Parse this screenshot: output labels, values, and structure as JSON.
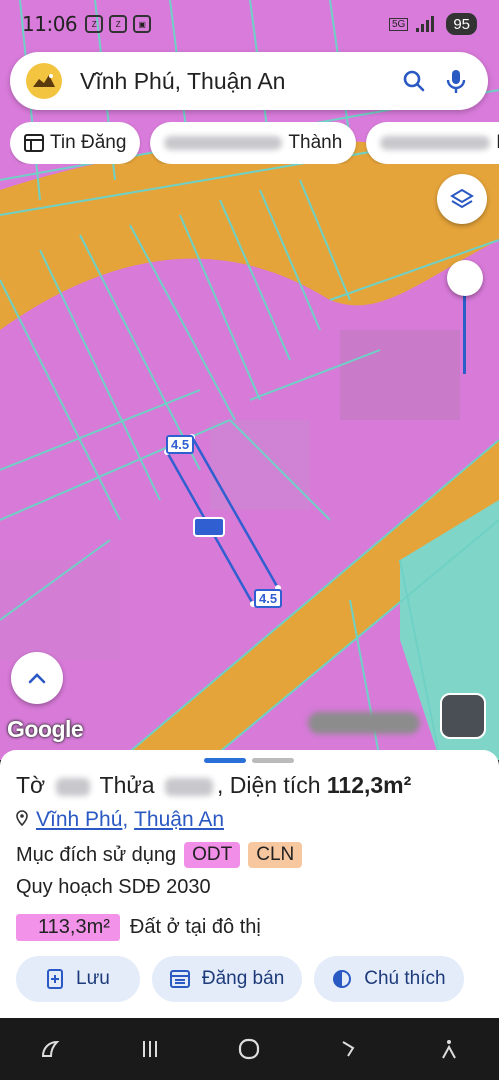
{
  "status_bar": {
    "time": "11:06",
    "network": "5G",
    "battery": "95"
  },
  "search": {
    "query": "Vĩnh Phú, Thuận An"
  },
  "chips": [
    {
      "label": "Tin Đăng"
    },
    {
      "label": "Thành"
    },
    {
      "label": "M"
    }
  ],
  "map": {
    "edge_label_top": "4.5",
    "edge_label_bottom": "4.5",
    "google_label": "Google"
  },
  "sheet": {
    "title_prefix": "Tờ",
    "title_middle": "Thửa",
    "title_suffix": ", Diện tích",
    "area": "112,3m²",
    "location_ward": "Vĩnh Phú",
    "location_sep": ",",
    "location_district": "Thuận An",
    "purpose_label": "Mục đích sử dụng",
    "purpose_tags": [
      {
        "code": "ODT",
        "color": "#f08ee8"
      },
      {
        "code": "CLN",
        "color": "#f7c7a0"
      }
    ],
    "plan_label": "Quy hoạch SDĐ 2030",
    "plan_area": "113,3m²",
    "plan_desc": "Đất ở tại đô thị"
  },
  "actions": [
    {
      "label": "Lưu",
      "icon": "bookmark-plus-icon"
    },
    {
      "label": "Đăng bán",
      "icon": "listing-icon"
    },
    {
      "label": "Chú thích",
      "icon": "contrast-icon"
    }
  ],
  "colors": {
    "residential": "#d77ad8",
    "road": "#e5a43a",
    "parcel_line": "#6fd1c5",
    "accent": "#2b59c3"
  }
}
